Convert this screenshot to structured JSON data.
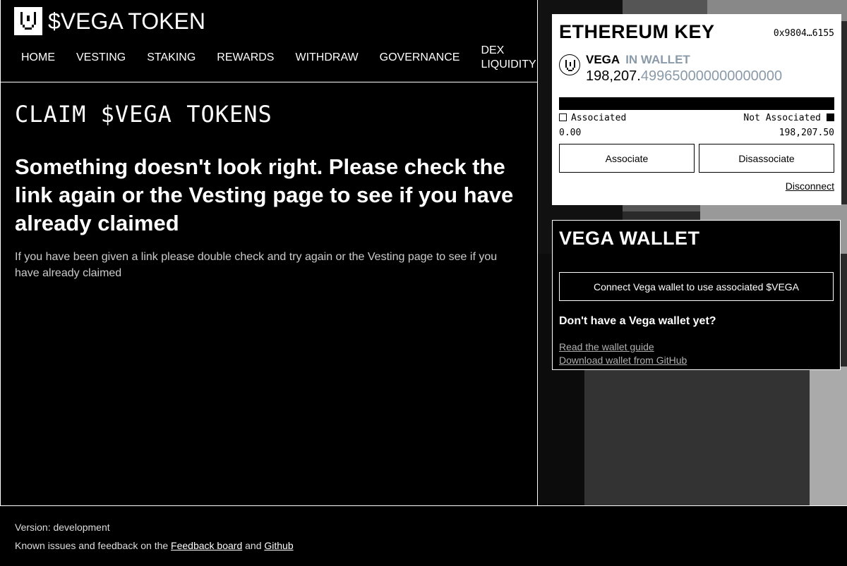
{
  "header": {
    "logo_text": "$VEGA TOKEN",
    "nav": [
      {
        "label": "HOME"
      },
      {
        "label": "VESTING"
      },
      {
        "label": "STAKING"
      },
      {
        "label": "REWARDS"
      },
      {
        "label": "WITHDRAW"
      },
      {
        "label": "GOVERNANCE"
      },
      {
        "label": "DEX LIQUIDITY"
      }
    ]
  },
  "main": {
    "page_title": "CLAIM $VEGA TOKENS",
    "error_heading": "Something doesn't look right. Please check the link again or the Vesting page to see if you have already claimed",
    "error_body": "If you have been given a link please double check and try again or the Vesting page to see if you have already claimed"
  },
  "ethereum_card": {
    "title": "ETHEREUM KEY",
    "address": "0x9804…6155",
    "token_name": "VEGA",
    "token_status": "IN WALLET",
    "amount_whole": "198,207.",
    "amount_decimals": "499650000000000000",
    "associated_label": "Associated",
    "not_associated_label": "Not Associated",
    "associated_value": "0.00",
    "not_associated_value": "198,207.50",
    "associate_button": "Associate",
    "disassociate_button": "Disassociate",
    "disconnect_link": "Disconnect"
  },
  "vega_wallet_card": {
    "title": "VEGA WALLET",
    "connect_button": "Connect Vega wallet to use associated $VEGA",
    "no_wallet_heading": "Don't have a Vega wallet yet?",
    "guide_link": "Read the wallet guide",
    "download_link": "Download wallet from GitHub"
  },
  "footer": {
    "version": "Version: development",
    "feedback_prefix": "Known issues and feedback on the ",
    "feedback_link": "Feedback board",
    "and_text": " and ",
    "github_link": "Github"
  },
  "colors": {
    "background": "#000000",
    "foreground": "#ffffff",
    "muted_accent": "#8a9aa8"
  }
}
